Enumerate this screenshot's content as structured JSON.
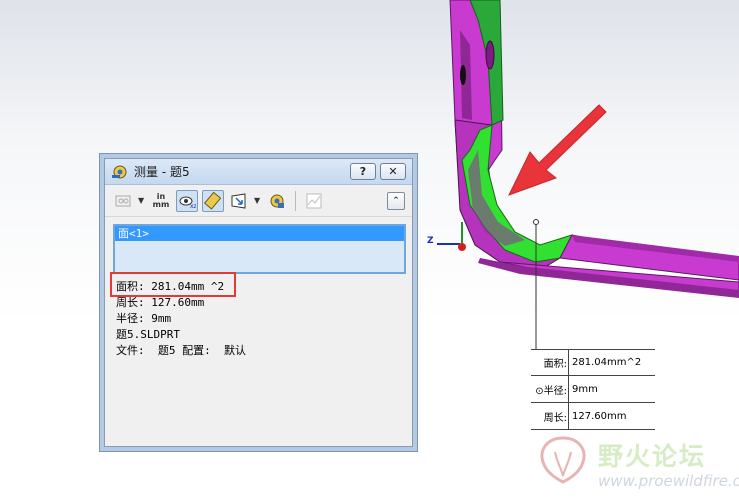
{
  "dialog": {
    "title": "测量 - 题5",
    "help_label": "?",
    "close_label": "✕",
    "toolbar": {
      "units_top": "in",
      "units_bottom": "mm",
      "collapse_label": "⌃"
    },
    "selection": [
      "面<1>"
    ],
    "results": {
      "area": "面积: 281.04mm ^2",
      "perimeter": "周长: 127.60mm",
      "radius": "半径: 9mm",
      "file": "题5.SLDPRT",
      "file_config": "文件:  题5 配置:  默认"
    }
  },
  "annotation": {
    "rows": [
      {
        "label": "面积:",
        "value": "281.04mm^2"
      },
      {
        "label": "⊙半径:",
        "value": "9mm"
      },
      {
        "label": "周长:",
        "value": "127.60mm"
      }
    ]
  },
  "triad": {
    "z_label": "Z"
  },
  "watermark": {
    "title": "野火论坛",
    "url": "www.proewildfire.cn"
  },
  "colors": {
    "part_magenta": "#c93ad1",
    "face_green": "#22cc22",
    "arrow_red": "#e8343a",
    "highlight_red": "#e53935",
    "selection_blue": "#3399ff"
  }
}
